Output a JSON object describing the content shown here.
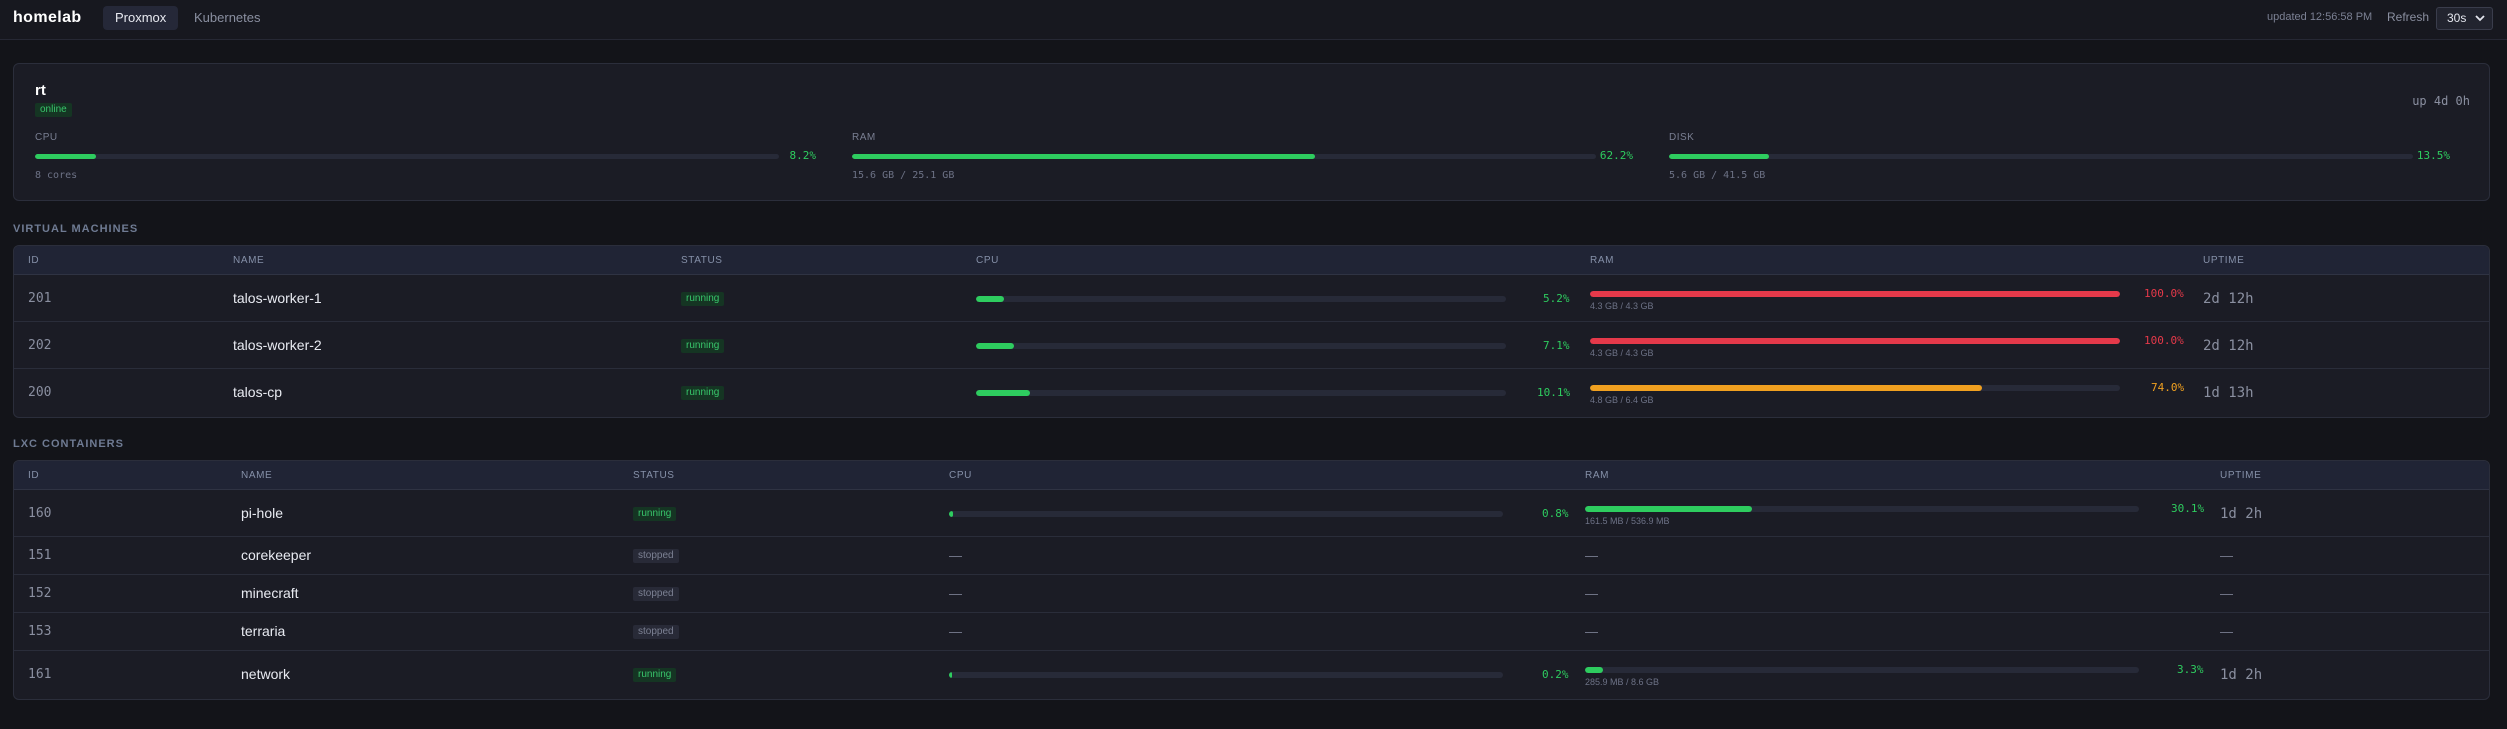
{
  "app": {
    "brand": "homelab",
    "tabs": [
      {
        "label": "Proxmox",
        "active": true
      },
      {
        "label": "Kubernetes",
        "active": false
      }
    ],
    "updated": "updated 12:56:58 PM",
    "refresh_label": "Refresh",
    "refresh_value": "30s"
  },
  "colors": {
    "green": "#2ecc5f",
    "red": "#e5394a",
    "orange": "#f0a020",
    "bg": "#131419",
    "card": "#1b1c25"
  },
  "node": {
    "name": "rt",
    "status": "online",
    "uptime": "up 4d 0h",
    "metrics": [
      {
        "label": "CPU",
        "pct": "8.2%",
        "value": 8.2,
        "sub": "8 cores"
      },
      {
        "label": "RAM",
        "pct": "62.2%",
        "value": 62.2,
        "sub": "15.6 GB / 25.1 GB"
      },
      {
        "label": "DISK",
        "pct": "13.5%",
        "value": 13.5,
        "sub": "5.6 GB / 41.5 GB"
      }
    ]
  },
  "vms": {
    "title": "VIRTUAL MACHINES",
    "columns": [
      "ID",
      "NAME",
      "STATUS",
      "CPU",
      "RAM",
      "UPTIME"
    ],
    "rows": [
      {
        "id": "201",
        "name": "talos-worker-1",
        "status": "running",
        "cpu_pct": "5.2%",
        "cpu": 5.2,
        "ram_pct": "100.0%",
        "ram": 100.0,
        "ram_color": "red",
        "ram_sub": "4.3 GB / 4.3 GB",
        "uptime": "2d 12h"
      },
      {
        "id": "202",
        "name": "talos-worker-2",
        "status": "running",
        "cpu_pct": "7.1%",
        "cpu": 7.1,
        "ram_pct": "100.0%",
        "ram": 100.0,
        "ram_color": "red",
        "ram_sub": "4.3 GB / 4.3 GB",
        "uptime": "2d 12h"
      },
      {
        "id": "200",
        "name": "talos-cp",
        "status": "running",
        "cpu_pct": "10.1%",
        "cpu": 10.1,
        "ram_pct": "74.0%",
        "ram": 74.0,
        "ram_color": "orange",
        "ram_sub": "4.8 GB / 6.4 GB",
        "uptime": "1d 13h"
      }
    ]
  },
  "lxc": {
    "title": "LXC CONTAINERS",
    "columns": [
      "ID",
      "NAME",
      "STATUS",
      "CPU",
      "RAM",
      "UPTIME"
    ],
    "dash": "—",
    "rows": [
      {
        "id": "160",
        "name": "pi-hole",
        "status": "running",
        "cpu_pct": "0.8%",
        "cpu": 0.8,
        "ram_pct": "30.1%",
        "ram": 30.1,
        "ram_color": "green",
        "ram_sub": "161.5 MB / 536.9 MB",
        "uptime": "1d 2h"
      },
      {
        "id": "151",
        "name": "corekeeper",
        "status": "stopped"
      },
      {
        "id": "152",
        "name": "minecraft",
        "status": "stopped"
      },
      {
        "id": "153",
        "name": "terraria",
        "status": "stopped"
      },
      {
        "id": "161",
        "name": "network",
        "status": "running",
        "cpu_pct": "0.2%",
        "cpu": 0.2,
        "ram_pct": "3.3%",
        "ram": 3.3,
        "ram_color": "green",
        "ram_sub": "285.9 MB / 8.6 GB",
        "uptime": "1d 2h"
      }
    ]
  }
}
